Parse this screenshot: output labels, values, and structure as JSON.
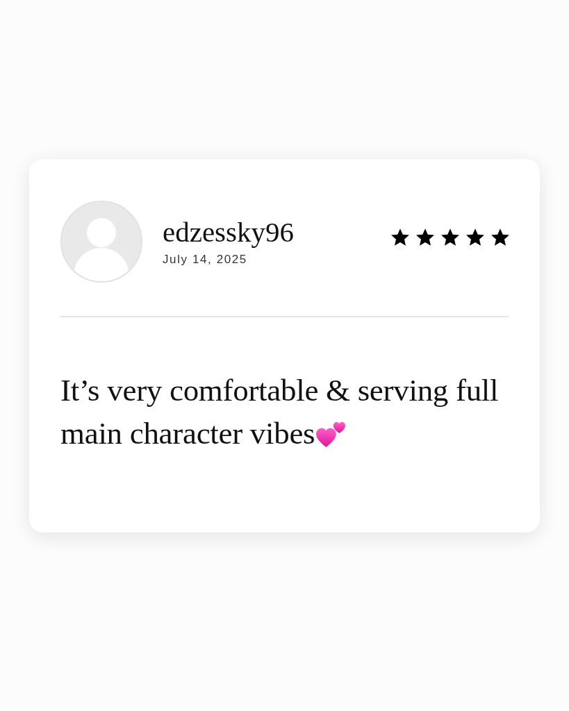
{
  "review": {
    "username": "edzessky96",
    "date": "July 14, 2025",
    "stars": 5,
    "text": "It’s very comfortable & serving full main character vibes"
  }
}
